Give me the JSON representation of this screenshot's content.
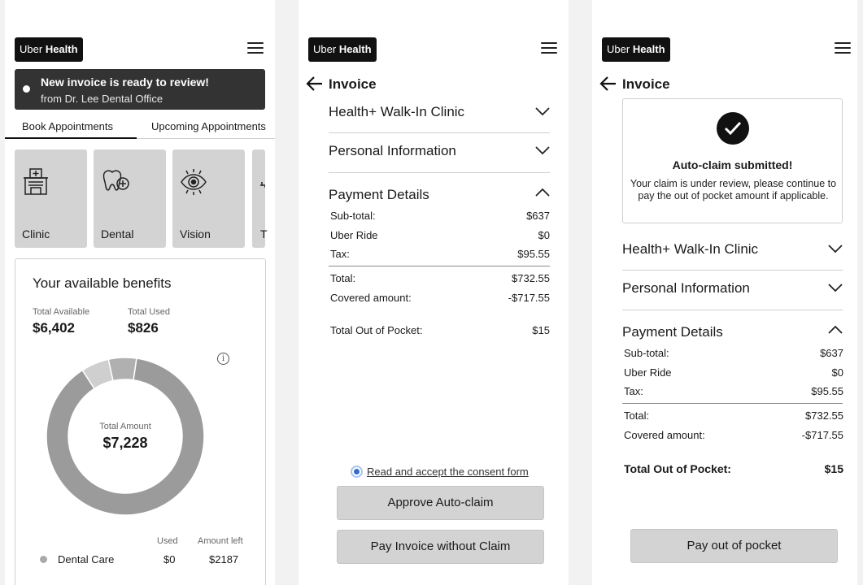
{
  "brand": {
    "prefix": "Uber",
    "name": "Health"
  },
  "screen1": {
    "notice": {
      "title": "New invoice is ready to review!",
      "subtitle": "from Dr. Lee Dental Office"
    },
    "tabs": [
      {
        "label": "Book Appointments",
        "active": true
      },
      {
        "label": "Upcoming Appointments",
        "active": false
      }
    ],
    "categories": [
      {
        "label": "Clinic",
        "icon": "clinic-icon"
      },
      {
        "label": "Dental",
        "icon": "dental-icon"
      },
      {
        "label": "Vision",
        "icon": "vision-icon"
      },
      {
        "label": "T",
        "icon": "partial-icon"
      }
    ],
    "benefits": {
      "title": "Your available benefits",
      "total_available_label": "Total Available",
      "total_available": "$6,402",
      "total_used_label": "Total Used",
      "total_used": "$826",
      "center_label": "Total Amount",
      "center_value": "$7,228",
      "table_headers": {
        "used": "Used",
        "left": "Amount left"
      },
      "rows": [
        {
          "category": "Dental Care",
          "used": "$0",
          "left": "$2187"
        }
      ]
    }
  },
  "chart_data": {
    "type": "pie",
    "total": 7228,
    "segments": [
      {
        "value": 6402,
        "color": "#9b9b9b"
      },
      {
        "value": 413,
        "color": "#cfcfcf"
      },
      {
        "value": 413,
        "color": "#b0b0b0"
      }
    ]
  },
  "screen2": {
    "title": "Invoice",
    "sections": [
      "Health+ Walk-In Clinic",
      "Personal Information"
    ],
    "payment_title": "Payment Details",
    "lines": [
      {
        "label": "Sub-total:",
        "value": "$637"
      },
      {
        "label": "Uber Ride",
        "value": "$0"
      },
      {
        "label": "Tax:",
        "value": "$95.55"
      },
      {
        "label": "Total:",
        "value": "$732.55"
      },
      {
        "label": "Covered amount:",
        "value": "-$717.55"
      },
      {
        "label": "Total Out of Pocket:",
        "value": "$15"
      }
    ],
    "consent_text": "Read and accept the consent form",
    "approve_label": "Approve Auto-claim",
    "pay_label": "Pay Invoice without Claim"
  },
  "screen3": {
    "title": "Invoice",
    "success_title": "Auto-claim submitted!",
    "success_text": "Your claim is under review, please continue to pay the out of pocket amount if applicable.",
    "sections": [
      "Health+ Walk-In Clinic",
      "Personal Information"
    ],
    "payment_title": "Payment Details",
    "lines": [
      {
        "label": "Sub-total:",
        "value": "$637"
      },
      {
        "label": "Uber Ride",
        "value": "$0"
      },
      {
        "label": "Tax:",
        "value": "$95.55"
      },
      {
        "label": "Total:",
        "value": "$732.55"
      },
      {
        "label": "Covered amount:",
        "value": "-$717.55"
      },
      {
        "label": "Total Out of Pocket:",
        "value": "$15"
      }
    ],
    "pay_label": "Pay out of pocket"
  }
}
